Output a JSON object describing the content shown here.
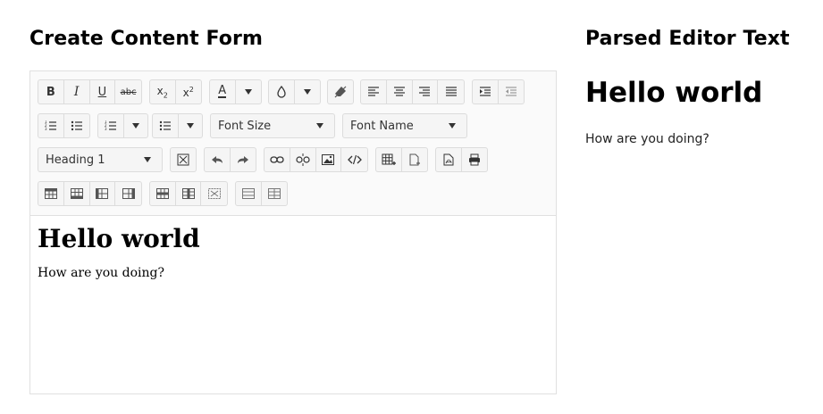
{
  "left_title": "Create Content Form",
  "right_title": "Parsed Editor Text",
  "toolbar": {
    "bold": "B",
    "italic": "I",
    "underline": "U",
    "strikethrough": "abc",
    "font_color": "A",
    "font_size": "Font Size",
    "font_name": "Font Name",
    "format": "Heading 1"
  },
  "editor": {
    "heading": "Hello world",
    "paragraph": "How are you doing?"
  },
  "parsed": {
    "heading": "Hello world",
    "paragraph": "How are you doing?"
  },
  "colors": {
    "border": "#e0e0e0",
    "toolbar_bg": "#fafafa",
    "button_bg": "#f5f5f5"
  }
}
